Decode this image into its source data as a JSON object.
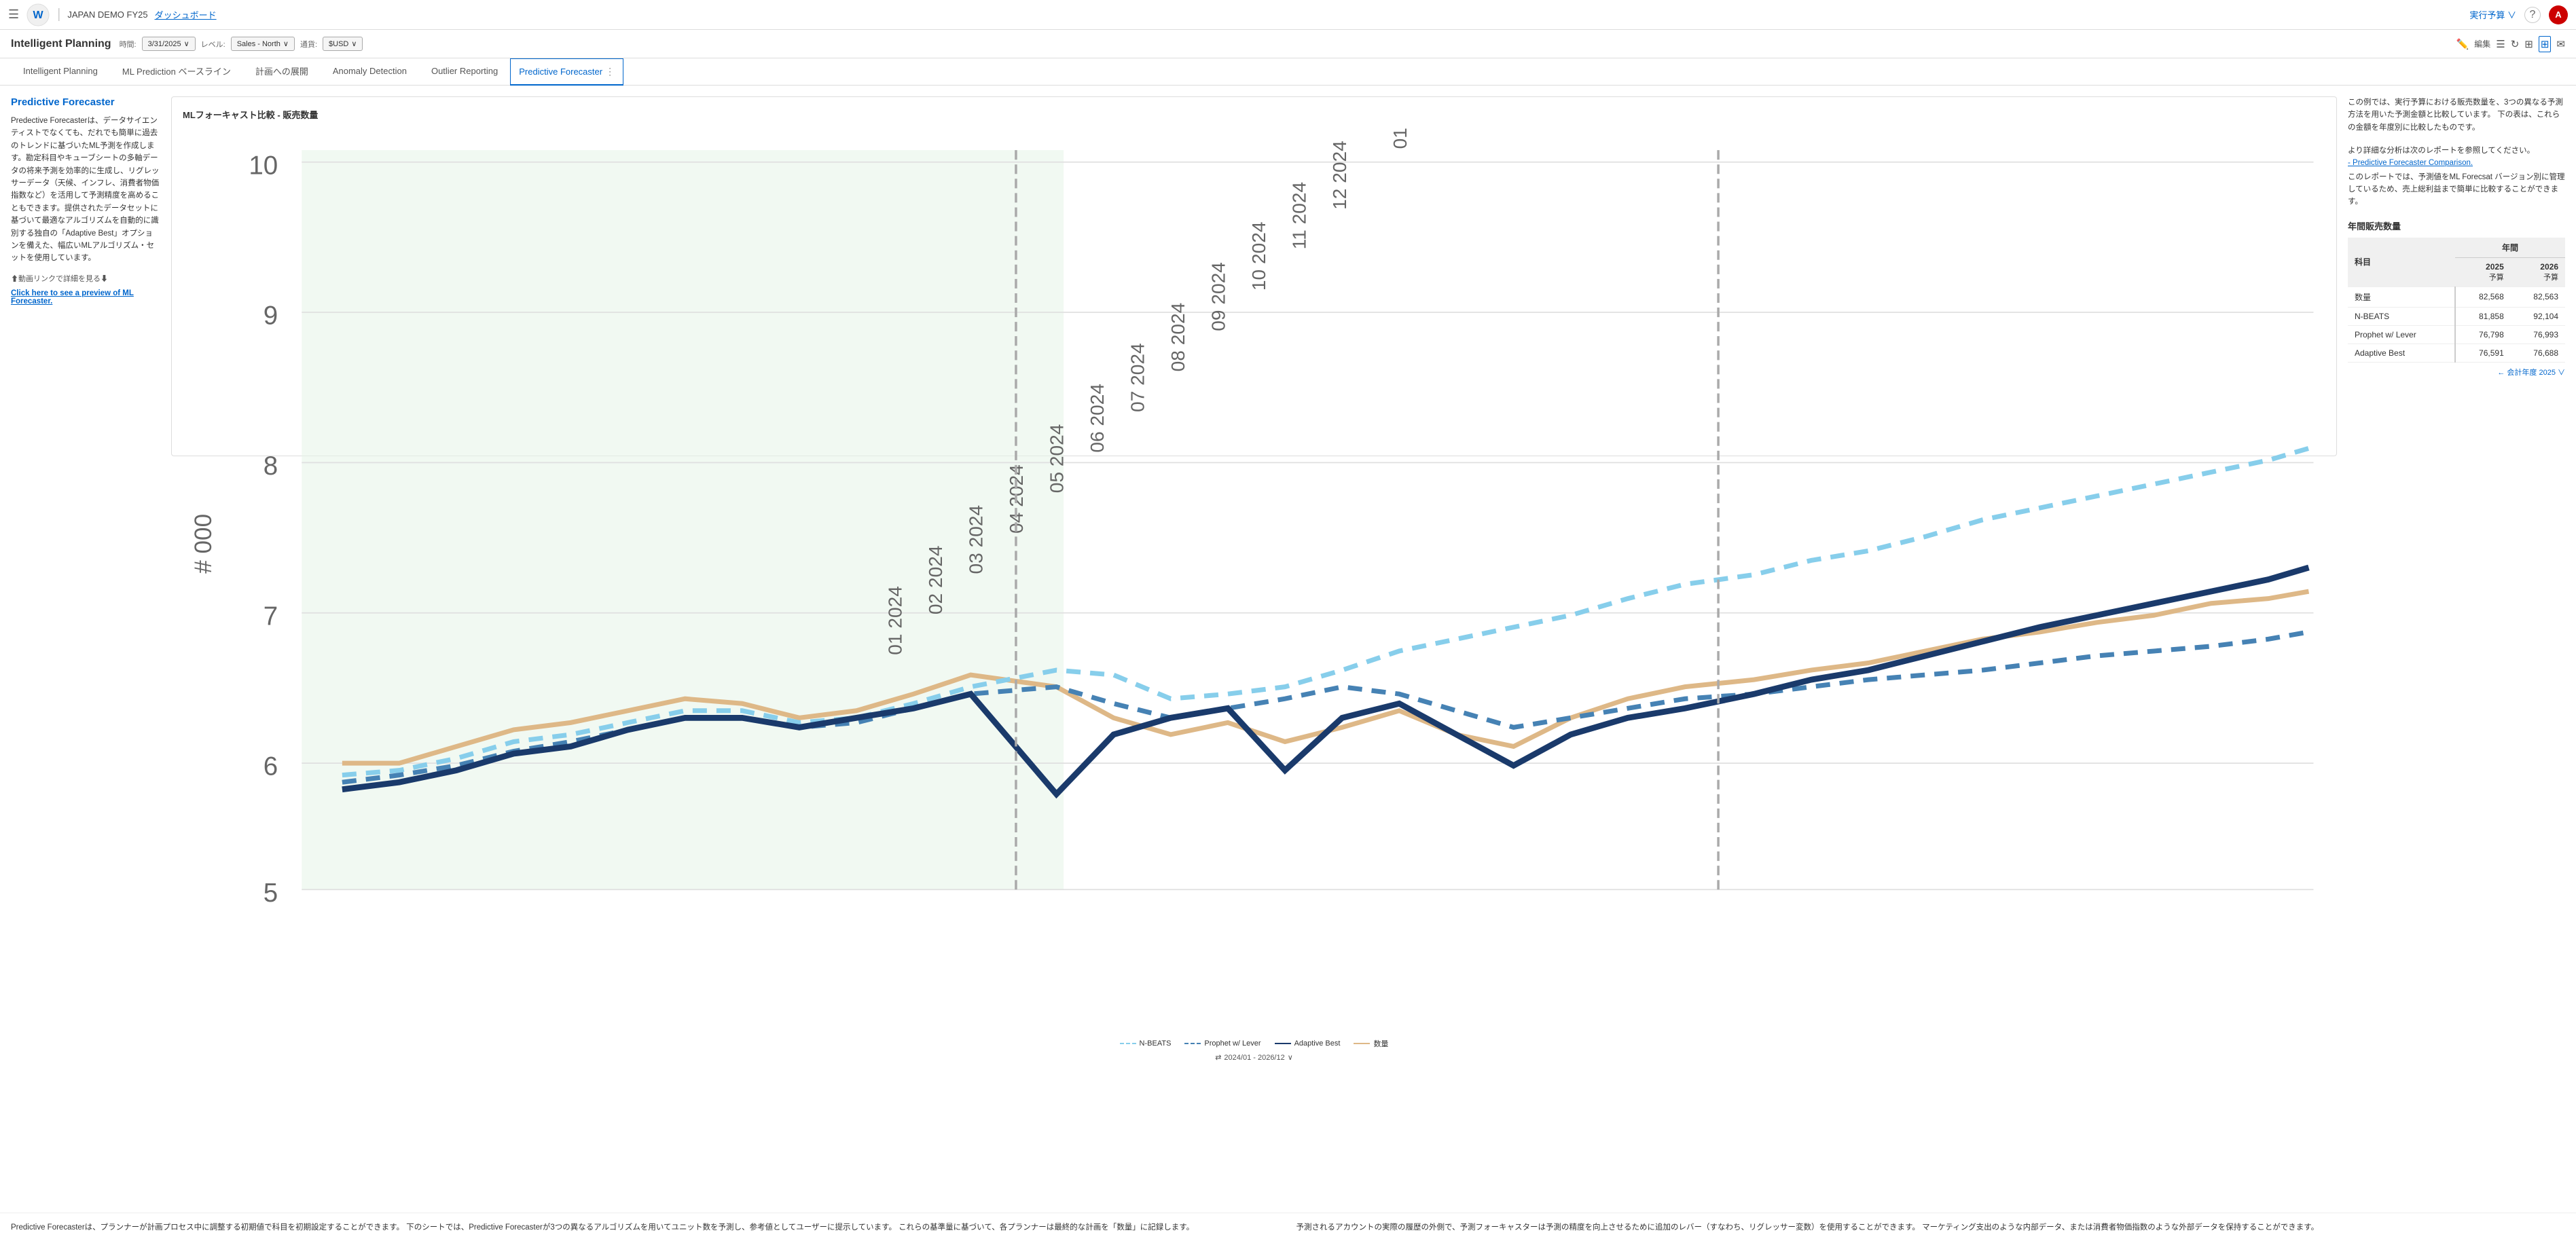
{
  "nav": {
    "hamburger": "☰",
    "logo_text": "W",
    "separator": "|",
    "company": "JAPAN DEMO FY25",
    "dashboard": "ダッシュボード",
    "budget_label": "実行予算",
    "help_icon": "?",
    "avatar_letter": "A"
  },
  "page_header": {
    "title": "Intelligent Planning",
    "time_label": "時間:",
    "time_value": "3/31/2025",
    "level_label": "レベル:",
    "level_value": "Sales - North",
    "currency_label": "通貨:",
    "currency_value": "$USD",
    "edit_label": "編集"
  },
  "tabs": [
    {
      "id": "intelligent-planning",
      "label": "Intelligent Planning",
      "active": false
    },
    {
      "id": "ml-prediction",
      "label": "ML Prediction ベースライン",
      "active": false
    },
    {
      "id": "plan-expansion",
      "label": "計画への展開",
      "active": false
    },
    {
      "id": "anomaly-detection",
      "label": "Anomaly Detection",
      "active": false
    },
    {
      "id": "outlier-reporting",
      "label": "Outlier Reporting",
      "active": false
    },
    {
      "id": "predictive-forecaster",
      "label": "Predictive Forecaster",
      "active": true,
      "has_menu": true
    }
  ],
  "chart": {
    "title": "MLフォーキャスト比較 - 販売数量",
    "y_axis_label": "# 000",
    "y_max": 10,
    "y_min": 5,
    "time_range": "2024/01 - 2026/12",
    "legend": [
      {
        "id": "n-beats",
        "label": "N-BEATS",
        "color": "#87CEEB",
        "style": "dashed"
      },
      {
        "id": "prophet",
        "label": "Prophet w/ Lever",
        "color": "#4682B4",
        "style": "dashed"
      },
      {
        "id": "adaptive",
        "label": "Adaptive Best",
        "color": "#1a3a6b",
        "style": "solid"
      },
      {
        "id": "quantity",
        "label": "数量",
        "color": "#DEB887",
        "style": "solid"
      }
    ]
  },
  "left_panel": {
    "title": "Predictive Forecaster",
    "description": "Predective Forecasterは、データサイエンティストでなくても、だれでも簡単に過去のトレンドに基づいたML予測を作成します。勘定科目やキューブシートの多軸データの将来予測を効率的に生成し、リグレッサーデータ（天候、インフレ、消費者物価指数など）を活用して予測精度を高めることもできます。提供されたデータセットに基づいて最適なアルゴリズムを自動的に識別する独自の「Adaptive Best」オプションを備えた、幅広いMLアルゴリズム・セットを使用しています。",
    "video_link": "⬆動画リンクで詳細を見る⬇",
    "preview_link": "Click here to see a preview of ML Forecaster."
  },
  "right_panel": {
    "description_1": "この例では、実行予算における販売数量を、3つの異なる予測方法を用いた予測金額と比較しています。 下の表は、これらの金額を年度別に比較したものです。",
    "description_2": "より詳細な分析は次のレポートを参照してください。",
    "link_label": "- Predictive Forecaster Comparison.",
    "description_3": "このレポートでは、予測値をML Forecsat バージョン別に管理しているため、売上総利益まで簡単に比較することができます。",
    "table_title": "年間販売数量",
    "table_headers": {
      "subject": "科目",
      "year_group": "年間",
      "year1": "2025",
      "year2": "2026",
      "sub1": "予算",
      "sub2": "予算"
    },
    "table_rows": [
      {
        "label": "数量",
        "val1": "82,568",
        "val2": "82,563"
      },
      {
        "label": "N-BEATS",
        "val1": "81,858",
        "val2": "92,104"
      },
      {
        "label": "Prophet w/ Lever",
        "val1": "76,798",
        "val2": "76,993"
      },
      {
        "label": "Adaptive Best",
        "val1": "76,591",
        "val2": "76,688"
      }
    ],
    "footer_link": "← 会計年度 2025 ∨"
  },
  "bottom": {
    "left_text": "Predictive Forecasterは、プランナーが計画プロセス中に調整する初期値で科目を初期設定することができます。 下のシートでは、Predictive Forecasterが3つの異なるアルゴリズムを用いてユニット数を予測し、参考値としてユーザーに提示しています。 これらの基準量に基づいて、各プランナーは最終的な計画を「数量」に記録します。",
    "right_text": "予測されるアカウントの実際の履歴の外側で、予測フォーキャスターは予測の精度を向上させるために追加のレバー（すなわち、リグレッサー変数）を使用することができます。 マーケティング支出のような内部データ、または消費者物価指数のような外部データを保持することができます。"
  }
}
